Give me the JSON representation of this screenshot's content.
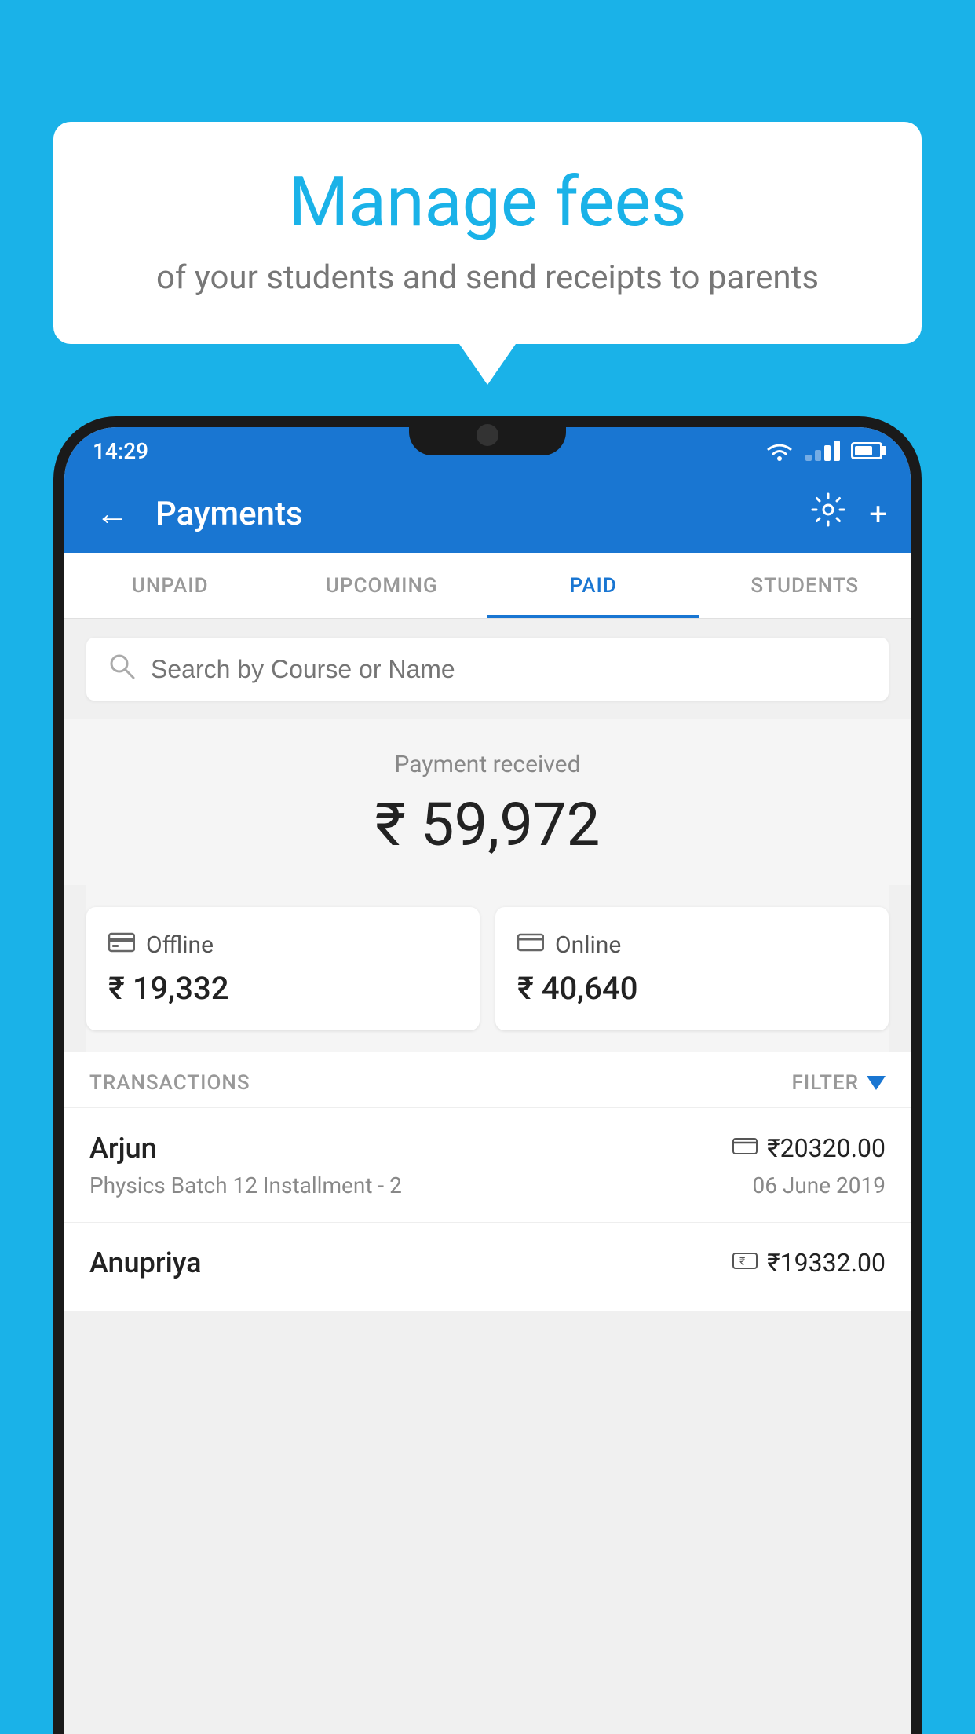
{
  "background_color": "#1ab2e8",
  "bubble": {
    "title": "Manage fees",
    "subtitle": "of your students and send receipts to parents"
  },
  "status_bar": {
    "time": "14:29"
  },
  "app_header": {
    "title": "Payments",
    "back_label": "←",
    "settings_label": "⚙",
    "add_label": "+"
  },
  "tabs": [
    {
      "label": "UNPAID",
      "active": false
    },
    {
      "label": "UPCOMING",
      "active": false
    },
    {
      "label": "PAID",
      "active": true
    },
    {
      "label": "STUDENTS",
      "active": false
    }
  ],
  "search": {
    "placeholder": "Search by Course or Name"
  },
  "payment_received": {
    "label": "Payment received",
    "amount": "₹ 59,972"
  },
  "payment_cards": [
    {
      "icon": "₹",
      "label": "Offline",
      "amount": "₹ 19,332"
    },
    {
      "icon": "▬",
      "label": "Online",
      "amount": "₹ 40,640"
    }
  ],
  "transactions_section": {
    "label": "TRANSACTIONS",
    "filter_label": "FILTER"
  },
  "transactions": [
    {
      "name": "Arjun",
      "course": "Physics Batch 12 Installment - 2",
      "amount": "₹20320.00",
      "date": "06 June 2019",
      "icon": "▬"
    },
    {
      "name": "Anupriya",
      "course": "",
      "amount": "₹19332.00",
      "date": "",
      "icon": "₹"
    }
  ]
}
